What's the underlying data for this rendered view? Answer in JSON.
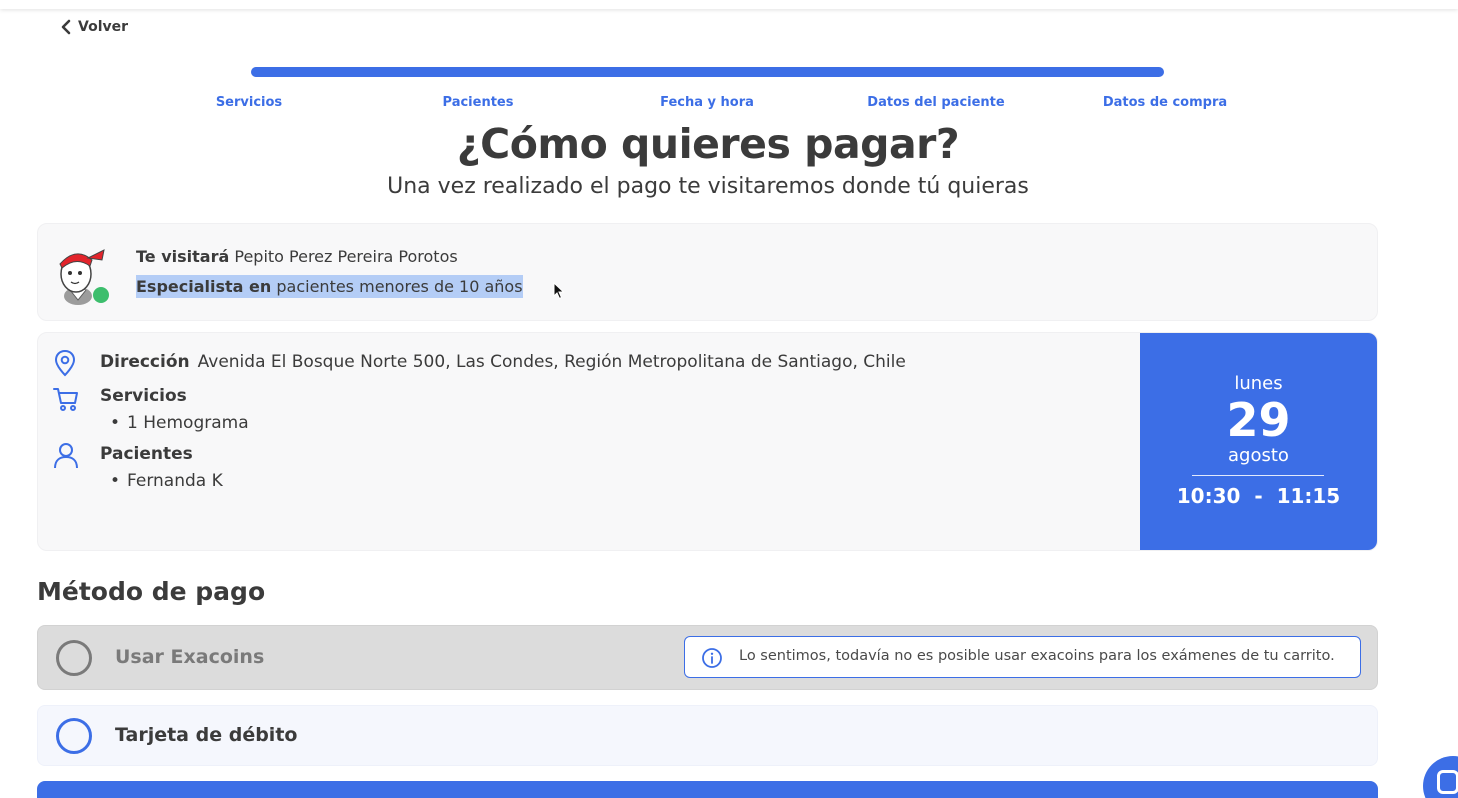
{
  "nav": {
    "back_label": "Volver"
  },
  "progress": {
    "fraction": 1.0
  },
  "steps": [
    "Servicios",
    "Pacientes",
    "Fecha y hora",
    "Datos del paciente",
    "Datos de compra"
  ],
  "header": {
    "title": "¿Cómo quieres pagar?",
    "subtitle": "Una vez realizado el pago te visitaremos donde tú quieras"
  },
  "professional": {
    "visit_label": "Te visitará",
    "name": "Pepito Perez Pereira Porotos",
    "specialist_label": "Especialista en",
    "specialty": "pacientes menores de 10 años",
    "status_color": "#3dbe6d"
  },
  "summary": {
    "address_label": "Dirección",
    "address": "Avenida El Bosque Norte 500, Las Condes, Región Metropolitana de Santiago, Chile",
    "services_label": "Servicios",
    "services": [
      "1 Hemograma"
    ],
    "patients_label": "Pacientes",
    "patients": [
      "Fernanda K"
    ]
  },
  "appointment": {
    "weekday": "lunes",
    "day": "29",
    "month": "agosto",
    "time_range": "10:30  -  11:15"
  },
  "payment": {
    "section_title": "Método de pago",
    "options": [
      {
        "label": "Usar Exacoins",
        "disabled": true
      },
      {
        "label": "Tarjeta de débito",
        "disabled": false
      }
    ],
    "exacoins_notice": "Lo sentimos, todavía no es posible usar exacoins para los exámenes de tu carrito."
  },
  "colors": {
    "accent": "#3c6ee6",
    "text": "#3b3b3b",
    "selection": "#b4cdf6"
  }
}
